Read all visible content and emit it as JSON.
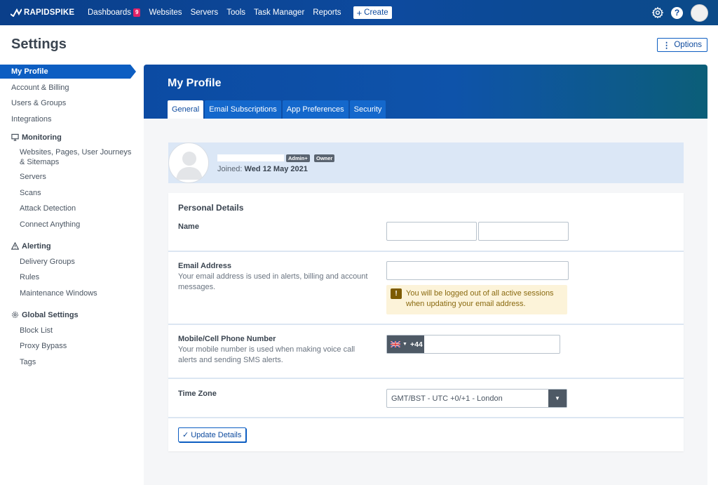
{
  "app": {
    "logo_text": "RAPIDSPIKE",
    "nav": [
      {
        "label": "Dashboards",
        "badge": "9"
      },
      {
        "label": "Websites"
      },
      {
        "label": "Servers"
      },
      {
        "label": "Tools"
      },
      {
        "label": "Task Manager"
      },
      {
        "label": "Reports"
      }
    ],
    "create_label": "Create",
    "help_label": "?",
    "colors": {
      "brand": "#0d4a9e",
      "accent": "#0d5ec2",
      "badge": "#e02266"
    }
  },
  "page": {
    "title": "Settings",
    "options_label": "Options"
  },
  "sidebar": {
    "top_items": [
      "My Profile",
      "Account & Billing",
      "Users & Groups",
      "Integrations"
    ],
    "monitoring": {
      "label": "Monitoring",
      "icon": "monitor-icon",
      "items": [
        "Websites, Pages, User Journeys & Sitemaps",
        "Servers",
        "Scans",
        "Attack Detection",
        "Connect Anything"
      ]
    },
    "alerting": {
      "label": "Alerting",
      "icon": "warning-triangle-icon",
      "items": [
        "Delivery Groups",
        "Rules",
        "Maintenance Windows"
      ]
    },
    "global": {
      "label": "Global Settings",
      "icon": "gear-icon",
      "items": [
        "Block List",
        "Proxy Bypass",
        "Tags"
      ]
    }
  },
  "profile": {
    "title": "My Profile",
    "tabs": [
      "General",
      "Email Subscriptions",
      "App Preferences",
      "Security"
    ],
    "badges": [
      "Admin+",
      "Owner"
    ],
    "joined_label": "Joined:",
    "joined_date": "Wed 12 May 2021"
  },
  "form": {
    "section_title": "Personal Details",
    "name_label": "Name",
    "email_label": "Email Address",
    "email_help": "Your email address is used in alerts, billing and account messages.",
    "email_warning": "You will be logged out of all active sessions when updating your email address.",
    "phone_label": "Mobile/Cell Phone Number",
    "phone_help": "Your mobile number is used when making voice call alerts and sending SMS alerts.",
    "phone_code": "+44",
    "timezone_label": "Time Zone",
    "timezone_value": "GMT/BST - UTC +0/+1 - London",
    "update_label": "Update Details"
  }
}
